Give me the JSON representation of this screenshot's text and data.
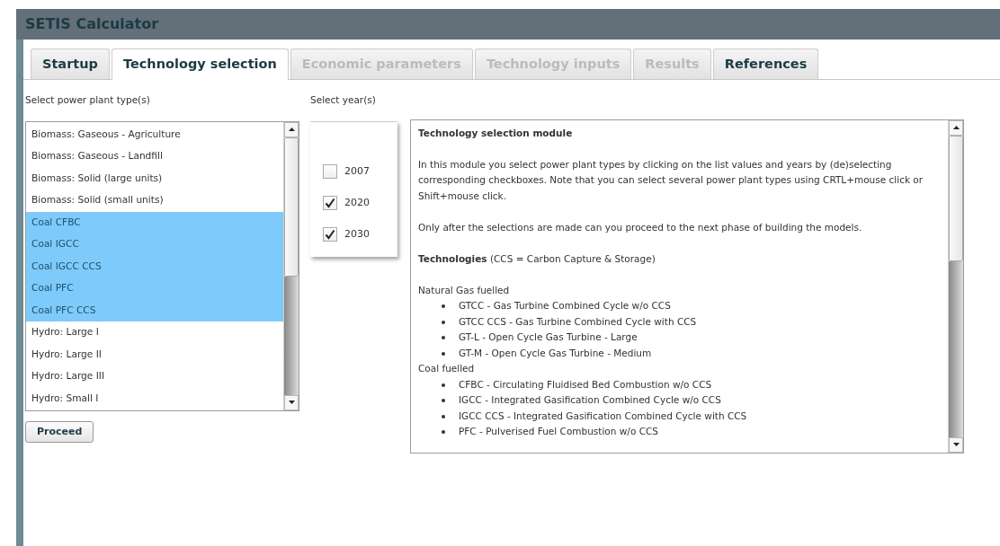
{
  "app": {
    "title": "SETIS Calculator"
  },
  "tabs": [
    {
      "label": "Startup",
      "selected": false,
      "disabled": false
    },
    {
      "label": "Technology selection",
      "selected": true,
      "disabled": false
    },
    {
      "label": "Economic parameters",
      "selected": false,
      "disabled": true
    },
    {
      "label": "Technology inputs",
      "selected": false,
      "disabled": true
    },
    {
      "label": "Results",
      "selected": false,
      "disabled": true
    },
    {
      "label": "References",
      "selected": false,
      "disabled": false
    }
  ],
  "plant_types": {
    "label": "Select power plant type(s)",
    "items": [
      {
        "label": "Biomass: Gaseous - Agriculture",
        "selected": false
      },
      {
        "label": "Biomass: Gaseous - Landfill",
        "selected": false
      },
      {
        "label": "Biomass: Solid (large units)",
        "selected": false
      },
      {
        "label": "Biomass: Solid (small units)",
        "selected": false
      },
      {
        "label": "Coal CFBC",
        "selected": true
      },
      {
        "label": "Coal IGCC",
        "selected": true
      },
      {
        "label": "Coal IGCC CCS",
        "selected": true
      },
      {
        "label": "Coal PFC",
        "selected": true
      },
      {
        "label": "Coal PFC CCS",
        "selected": true
      },
      {
        "label": "Hydro: Large I",
        "selected": false
      },
      {
        "label": "Hydro: Large II",
        "selected": false
      },
      {
        "label": "Hydro: Large III",
        "selected": false
      },
      {
        "label": "Hydro: Small I",
        "selected": false
      }
    ]
  },
  "years": {
    "label": "Select year(s)",
    "items": [
      {
        "label": "2007",
        "checked": false
      },
      {
        "label": "2020",
        "checked": true
      },
      {
        "label": "2030",
        "checked": true
      }
    ]
  },
  "proceed_button": "Proceed",
  "info": {
    "title": "Technology selection module",
    "paragraphs": [
      "In this module you select power plant types by clicking on the list values and years by (de)selecting corresponding checkboxes. Note that you can select several power plant types using CRTL+mouse click or Shift+mouse click.",
      "Only after the selections are made can you proceed to the next phase of building the models.",
      "**Technologies** (CCS = Carbon Capture & Storage)"
    ],
    "groups": [
      {
        "heading": "Natural Gas fuelled",
        "items": [
          "GTCC - Gas Turbine Combined Cycle w/o CCS",
          "GTCC CCS - Gas Turbine Combined Cycle with CCS",
          "GT-L - Open Cycle Gas Turbine - Large",
          "GT-M - Open Cycle Gas Turbine - Medium"
        ]
      },
      {
        "heading": "Coal fuelled",
        "items": [
          "CFBC - Circulating Fluidised Bed Combustion w/o CCS",
          "IGCC - Integrated Gasification Combined Cycle w/o CCS",
          "IGCC CCS - Integrated Gasification Combined Cycle with CCS",
          "PFC - Pulverised Fuel Combustion w/o CCS"
        ]
      }
    ]
  }
}
